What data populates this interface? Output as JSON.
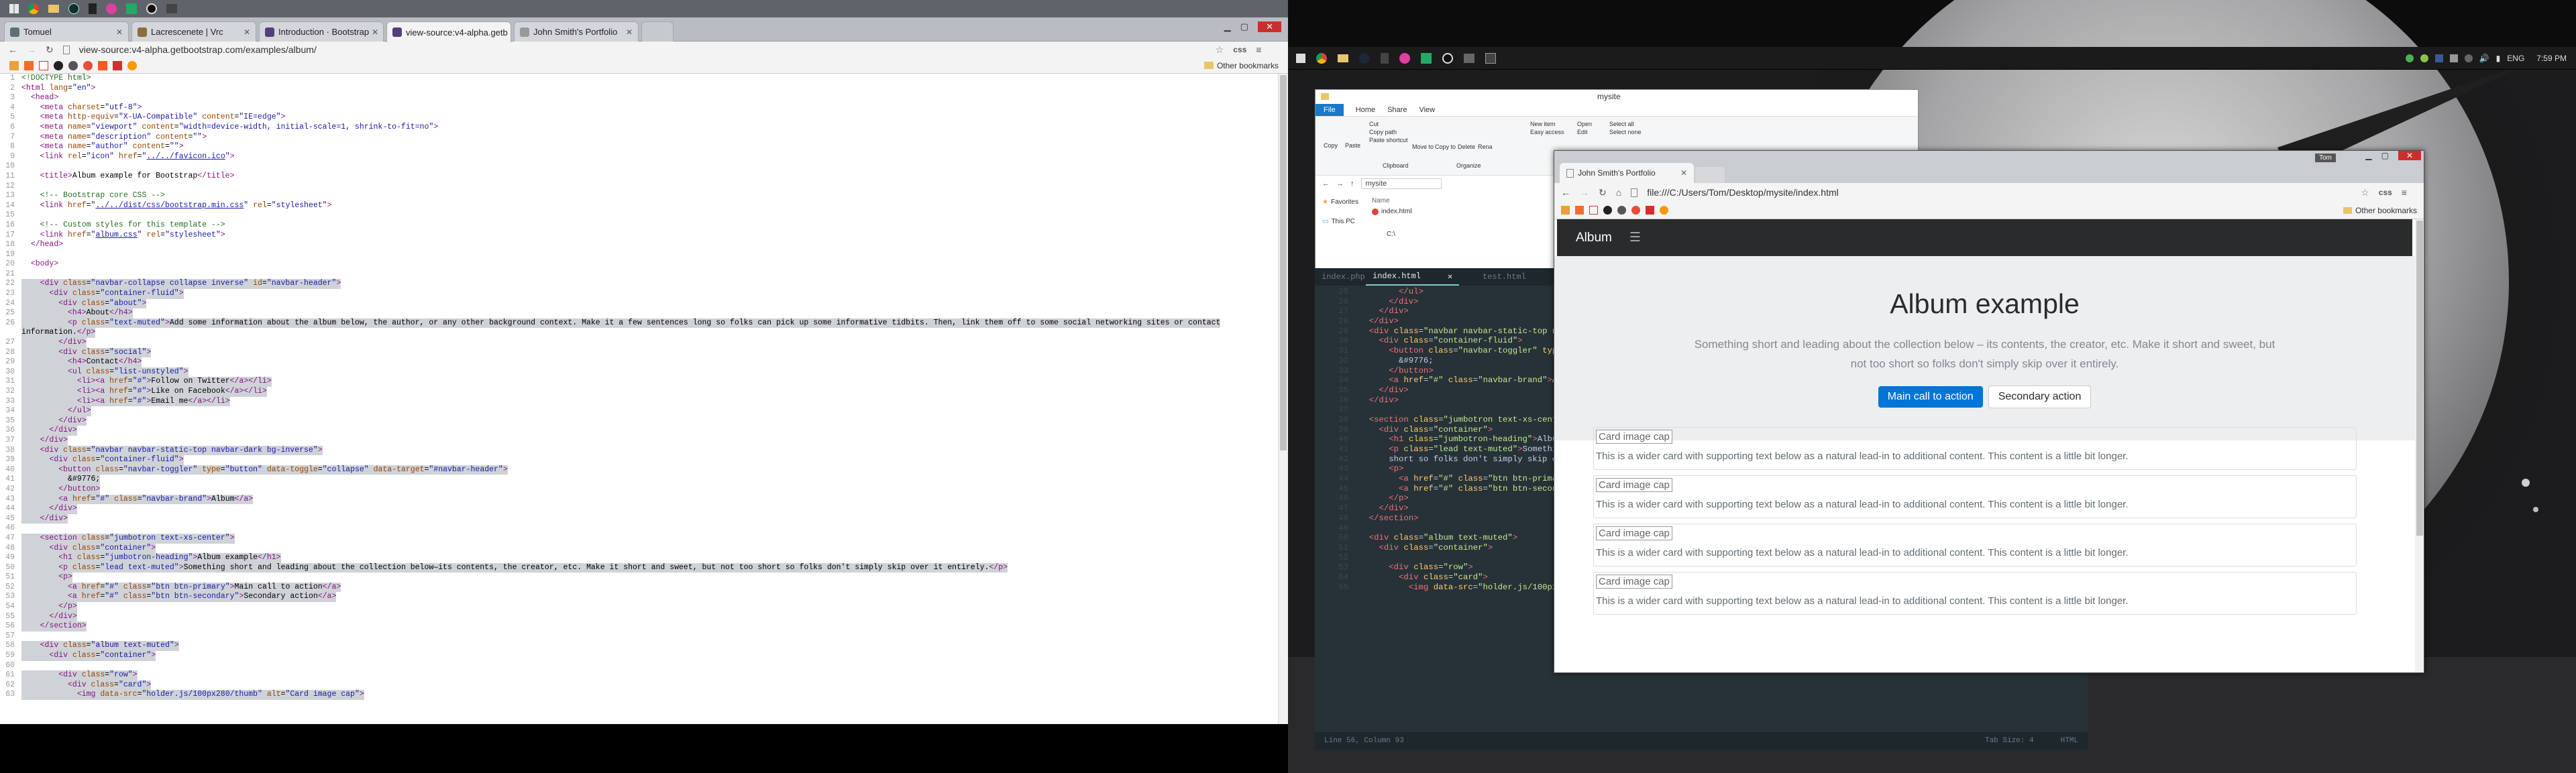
{
  "left_browser": {
    "tabs": [
      {
        "label": "Tomuel",
        "color": "#5f6f7a"
      },
      {
        "label": "Lacrescenete | Vrc",
        "color": "#8a6d3b"
      },
      {
        "label": "Introduction · Bootstrap",
        "color": "#563d7c"
      },
      {
        "label": "view-source:v4-alpha.getb",
        "color": "#563d7c"
      },
      {
        "label": "John Smith's Portfolio",
        "color": "#999999"
      }
    ],
    "url": "view-source:v4-alpha.getbootstrap.com/examples/album/",
    "url_suffix": "css",
    "other_bookmarks": "Other bookmarks",
    "code_lines": [
      {
        "html": "<span class='c'>&lt;!DOCTYPE html&gt;</span>"
      },
      {
        "html": "<span class='t'>&lt;html</span> <span class='a'>lang</span>=<span class='v'>\"en\"</span><span class='t'>&gt;</span>"
      },
      {
        "html": "  <span class='t'>&lt;head&gt;</span>"
      },
      {
        "html": "    <span class='t'>&lt;meta</span> <span class='a'>charset</span>=<span class='v'>\"utf-8\"</span><span class='t'>&gt;</span>"
      },
      {
        "html": "    <span class='t'>&lt;meta</span> <span class='a'>http-equiv</span>=<span class='v'>\"X-UA-Compatible\"</span> <span class='a'>content</span>=<span class='v'>\"IE=edge\"</span><span class='t'>&gt;</span>"
      },
      {
        "html": "    <span class='t'>&lt;meta</span> <span class='a'>name</span>=<span class='v'>\"viewport\"</span> <span class='a'>content</span>=<span class='v'>\"width=device-width, initial-scale=1, shrink-to-fit=no\"</span><span class='t'>&gt;</span>"
      },
      {
        "html": "    <span class='t'>&lt;meta</span> <span class='a'>name</span>=<span class='v'>\"description\"</span> <span class='a'>content</span>=<span class='v'>\"\"</span><span class='t'>&gt;</span>"
      },
      {
        "html": "    <span class='t'>&lt;meta</span> <span class='a'>name</span>=<span class='v'>\"author\"</span> <span class='a'>content</span>=<span class='v'>\"\"</span><span class='t'>&gt;</span>"
      },
      {
        "html": "    <span class='t'>&lt;link</span> <span class='a'>rel</span>=<span class='v'>\"icon\"</span> <span class='a'>href</span>=<span class='v'>\"</span><span class='lk'>../../favicon.ico</span><span class='v'>\"</span><span class='t'>&gt;</span>"
      },
      {
        "html": ""
      },
      {
        "html": "    <span class='t'>&lt;title&gt;</span>Album example for Bootstrap<span class='t'>&lt;/title&gt;</span>"
      },
      {
        "html": ""
      },
      {
        "html": "    <span class='c'>&lt;!-- Bootstrap core CSS --&gt;</span>"
      },
      {
        "html": "    <span class='t'>&lt;link</span> <span class='a'>href</span>=<span class='v'>\"</span><span class='lk'>../../dist/css/bootstrap.min.css</span><span class='v'>\"</span> <span class='a'>rel</span>=<span class='v'>\"stylesheet\"</span><span class='t'>&gt;</span>"
      },
      {
        "html": ""
      },
      {
        "html": "    <span class='c'>&lt;!-- Custom styles for this template --&gt;</span>"
      },
      {
        "html": "    <span class='t'>&lt;link</span> <span class='a'>href</span>=<span class='v'>\"</span><span class='lk'>album.css</span><span class='v'>\"</span> <span class='a'>rel</span>=<span class='v'>\"stylesheet\"</span><span class='t'>&gt;</span>"
      },
      {
        "html": "  <span class='t'>&lt;/head&gt;</span>"
      },
      {
        "html": ""
      },
      {
        "html": "  <span class='t'>&lt;body&gt;</span>"
      },
      {
        "html": ""
      },
      {
        "html": "    <span class='t'>&lt;div</span> <span class='a'>class</span>=<span class='v'>\"navbar-collapse collapse inverse\"</span> <span class='a'>id</span>=<span class='v'>\"navbar-header\"</span><span class='t'>&gt;</span>",
        "sel": true
      },
      {
        "html": "      <span class='t'>&lt;div</span> <span class='a'>class</span>=<span class='v'>\"container-fluid\"</span><span class='t'>&gt;</span>",
        "sel": true
      },
      {
        "html": "        <span class='t'>&lt;div</span> <span class='a'>class</span>=<span class='v'>\"about\"</span><span class='t'>&gt;</span>",
        "sel": true
      },
      {
        "html": "          <span class='t'>&lt;h4&gt;</span>About<span class='t'>&lt;/h4&gt;</span>",
        "sel": true
      },
      {
        "html": "          <span class='t'>&lt;p</span> <span class='a'>class</span>=<span class='v'>\"text-muted\"</span><span class='t'>&gt;</span>Add some information about the album below, the author, or any other background context. Make it a few sentences long so folks can pick up some informative tidbits. Then, link them off to some social networking sites or contact",
        "sel": true
      },
      {
        "html": "information.<span class='t'>&lt;/p&gt;</span>",
        "sel": true,
        "nonum": true
      },
      {
        "html": "        <span class='t'>&lt;/div&gt;</span>",
        "sel": true
      },
      {
        "html": "        <span class='t'>&lt;div</span> <span class='a'>class</span>=<span class='v'>\"social\"</span><span class='t'>&gt;</span>",
        "sel": true
      },
      {
        "html": "          <span class='t'>&lt;h4&gt;</span>Contact<span class='t'>&lt;/h4&gt;</span>",
        "sel": true
      },
      {
        "html": "          <span class='t'>&lt;ul</span> <span class='a'>class</span>=<span class='v'>\"list-unstyled\"</span><span class='t'>&gt;</span>",
        "sel": true
      },
      {
        "html": "            <span class='t'>&lt;li&gt;&lt;a</span> <span class='a'>href</span>=<span class='v'>\"#\"</span><span class='t'>&gt;</span>Follow on Twitter<span class='t'>&lt;/a&gt;&lt;/li&gt;</span>",
        "sel": true
      },
      {
        "html": "            <span class='t'>&lt;li&gt;&lt;a</span> <span class='a'>href</span>=<span class='v'>\"#\"</span><span class='t'>&gt;</span>Like on Facebook<span class='t'>&lt;/a&gt;&lt;/li&gt;</span>",
        "sel": true
      },
      {
        "html": "            <span class='t'>&lt;li&gt;&lt;a</span> <span class='a'>href</span>=<span class='v'>\"#\"</span><span class='t'>&gt;</span>Email me<span class='t'>&lt;/a&gt;&lt;/li&gt;</span>",
        "sel": true
      },
      {
        "html": "          <span class='t'>&lt;/ul&gt;</span>",
        "sel": true
      },
      {
        "html": "        <span class='t'>&lt;/div&gt;</span>",
        "sel": true
      },
      {
        "html": "      <span class='t'>&lt;/div&gt;</span>",
        "sel": true
      },
      {
        "html": "    <span class='t'>&lt;/div&gt;</span>",
        "sel": true
      },
      {
        "html": "    <span class='t'>&lt;div</span> <span class='a'>class</span>=<span class='v'>\"navbar navbar-static-top navbar-dark bg-inverse\"</span><span class='t'>&gt;</span>",
        "sel": true
      },
      {
        "html": "      <span class='t'>&lt;div</span> <span class='a'>class</span>=<span class='v'>\"container-fluid\"</span><span class='t'>&gt;</span>",
        "sel": true
      },
      {
        "html": "        <span class='t'>&lt;button</span> <span class='a'>class</span>=<span class='v'>\"navbar-toggler\"</span> <span class='a'>type</span>=<span class='v'>\"button\"</span> <span class='a'>data-toggle</span>=<span class='v'>\"collapse\"</span> <span class='a'>data-target</span>=<span class='v'>\"#navbar-header\"</span><span class='t'>&gt;</span>",
        "sel": true
      },
      {
        "html": "          &amp;#9776;",
        "sel": true
      },
      {
        "html": "        <span class='t'>&lt;/button&gt;</span>",
        "sel": true
      },
      {
        "html": "        <span class='t'>&lt;a</span> <span class='a'>href</span>=<span class='v'>\"#\"</span> <span class='a'>class</span>=<span class='v'>\"navbar-brand\"</span><span class='t'>&gt;</span>Album<span class='t'>&lt;/a&gt;</span>",
        "sel": true
      },
      {
        "html": "      <span class='t'>&lt;/div&gt;</span>",
        "sel": true
      },
      {
        "html": "    <span class='t'>&lt;/div&gt;</span>",
        "sel": true
      },
      {
        "html": ""
      },
      {
        "html": "    <span class='t'>&lt;section</span> <span class='a'>class</span>=<span class='v'>\"jumbotron text-xs-center\"</span><span class='t'>&gt;</span>",
        "sel": true
      },
      {
        "html": "      <span class='t'>&lt;div</span> <span class='a'>class</span>=<span class='v'>\"container\"</span><span class='t'>&gt;</span>",
        "sel": true
      },
      {
        "html": "        <span class='t'>&lt;h1</span> <span class='a'>class</span>=<span class='v'>\"jumbotron-heading\"</span><span class='t'>&gt;</span>Album example<span class='t'>&lt;/h1&gt;</span>",
        "sel": true
      },
      {
        "html": "        <span class='t'>&lt;p</span> <span class='a'>class</span>=<span class='v'>\"lead text-muted\"</span><span class='t'>&gt;</span>Something short and leading about the collection below—its contents, the creator, etc. Make it short and sweet, but not too short so folks don't simply skip over it entirely.<span class='t'>&lt;/p&gt;</span>",
        "sel": true
      },
      {
        "html": "        <span class='t'>&lt;p&gt;</span>",
        "sel": true
      },
      {
        "html": "          <span class='t'>&lt;a</span> <span class='a'>href</span>=<span class='v'>\"#\"</span> <span class='a'>class</span>=<span class='v'>\"btn btn-primary\"</span><span class='t'>&gt;</span>Main call to action<span class='t'>&lt;/a&gt;</span>",
        "sel": true
      },
      {
        "html": "          <span class='t'>&lt;a</span> <span class='a'>href</span>=<span class='v'>\"#\"</span> <span class='a'>class</span>=<span class='v'>\"btn btn-secondary\"</span><span class='t'>&gt;</span>Secondary action<span class='t'>&lt;/a&gt;</span>",
        "sel": true
      },
      {
        "html": "        <span class='t'>&lt;/p&gt;</span>",
        "sel": true
      },
      {
        "html": "      <span class='t'>&lt;/div&gt;</span>",
        "sel": true
      },
      {
        "html": "    <span class='t'>&lt;/section&gt;</span>",
        "sel": true
      },
      {
        "html": ""
      },
      {
        "html": "    <span class='t'>&lt;div</span> <span class='a'>class</span>=<span class='v'>\"album text-muted\"</span><span class='t'>&gt;</span>",
        "sel": true
      },
      {
        "html": "      <span class='t'>&lt;div</span> <span class='a'>class</span>=<span class='v'>\"container\"</span><span class='t'>&gt;</span>",
        "sel": true
      },
      {
        "html": ""
      },
      {
        "html": "        <span class='t'>&lt;div</span> <span class='a'>class</span>=<span class='v'>\"row\"</span><span class='t'>&gt;</span>",
        "sel": true
      },
      {
        "html": "          <span class='t'>&lt;div</span> <span class='a'>class</span>=<span class='v'>\"card\"</span><span class='t'>&gt;</span>",
        "sel": true
      },
      {
        "html": "            <span class='t'>&lt;img</span> <span class='a'>data-src</span>=<span class='v'>\"holder.js/100px280/thumb\"</span> <span class='a'>alt</span>=<span class='v'>\"Card image cap\"</span><span class='t'>&gt;</span>",
        "sel": true
      }
    ]
  },
  "taskbar": {
    "language": "ENG",
    "time": "7:59 PM"
  },
  "explorer": {
    "title": "mysite",
    "ribbon_tabs": [
      "File",
      "Home",
      "Share",
      "View"
    ],
    "ribbon_buttons": [
      "Copy",
      "Paste",
      "Cut",
      "Copy path",
      "Paste shortcut",
      "Move to",
      "Copy to",
      "Delete",
      "Rena",
      "New item",
      "Easy access",
      "Open",
      "Edit",
      "Select all",
      "Select none"
    ],
    "groups": [
      "Clipboard",
      "Organize"
    ],
    "path": "mysite",
    "quick_access": [
      "Favorites",
      "This PC"
    ],
    "column": "Name",
    "file": "index.html",
    "drive": "C:\\"
  },
  "editor": {
    "tabs": [
      "index.php",
      "index.html",
      "test.html"
    ],
    "line_numbers": [
      25,
      26,
      27,
      28,
      29,
      30,
      31,
      32,
      33,
      34,
      35,
      36,
      37,
      38,
      39,
      40,
      41,
      42,
      43,
      44,
      45,
      46,
      47,
      48,
      49,
      50,
      51,
      52,
      53,
      54,
      55,
      56,
      57,
      58,
      59,
      60,
      61,
      62,
      63,
      64,
      65,
      66,
      67,
      68,
      69,
      70,
      71,
      72,
      73,
      74,
      75,
      76,
      77
    ],
    "lines": [
      "        <span class='et'>&lt;/ul&gt;</span>",
      "      <span class='et'>&lt;/div&gt;</span>",
      "    <span class='et'>&lt;/div&gt;</span>",
      "  <span class='et'>&lt;/div&gt;</span>",
      "  <span class='et'>&lt;div</span> <span class='ea'>class</span>=<span class='ev'>\"navbar navbar-static-top navbar-dark bg-inverse\"</span><span class='et'>&gt;</span>",
      "    <span class='et'>&lt;div</span> <span class='ea'>class</span>=<span class='ev'>\"container-fluid\"</span><span class='et'>&gt;</span>",
      "      <span class='et'>&lt;button</span> <span class='ea'>class</span>=<span class='ev'>\"navbar-toggler\"</span> <span class='ea'>type</span>=<span class='ev'>\"button\"</span> <span class='ea'>data-toggle</span>=<span class='ev'>\"collapse\"</span>",
      "        &amp;#9776;",
      "      <span class='et'>&lt;/button&gt;</span>",
      "      <span class='et'>&lt;a</span> <span class='ea'>href</span>=<span class='ev'>\"#\"</span> <span class='ea'>class</span>=<span class='ev'>\"navbar-brand\"</span><span class='et'>&gt;</span>Album<span class='et'>&lt;/a&gt;</span>",
      "    <span class='et'>&lt;/div&gt;</span>",
      "  <span class='et'>&lt;/div&gt;</span>",
      "",
      "  <span class='et'>&lt;section</span> <span class='ea'>class</span>=<span class='ev'>\"jumbotron text-xs-center\"</span><span class='et'>&gt;</span>",
      "    <span class='et'>&lt;div</span> <span class='ea'>class</span>=<span class='ev'>\"container\"</span><span class='et'>&gt;</span>",
      "      <span class='et'>&lt;h1</span> <span class='ea'>class</span>=<span class='ev'>\"jumbotron-heading\"</span><span class='et'>&gt;</span>Album example<span class='et'>&lt;/h1&gt;</span>",
      "      <span class='et'>&lt;p</span> <span class='ea'>class</span>=<span class='ev'>\"lead text-muted\"</span><span class='et'>&gt;</span>Something short and leading about the collection below",
      "      short so folks don't simply skip over it entirely.<span class='et'>&lt;/p&gt;</span>",
      "      <span class='et'>&lt;p&gt;</span>",
      "        <span class='et'>&lt;a</span> <span class='ea'>href</span>=<span class='ev'>\"#\"</span> <span class='ea'>class</span>=<span class='ev'>\"btn btn-primary\"</span><span class='et'>&gt;</span>Main call to action<span class='et'>&lt;/a&gt;</span>",
      "        <span class='et'>&lt;a</span> <span class='ea'>href</span>=<span class='ev'>\"#\"</span> <span class='ea'>class</span>=<span class='ev'>\"btn btn-secondary\"</span><span class='et'>&gt;</span>Secondary action<span class='et'>&lt;/a&gt;</span>",
      "      <span class='et'>&lt;/p&gt;</span>",
      "    <span class='et'>&lt;/div&gt;</span>",
      "  <span class='et'>&lt;/section&gt;</span>",
      "",
      "  <span class='et'>&lt;div</span> <span class='ea'>class</span>=<span class='ev'>\"album text-muted\"</span><span class='et'>&gt;</span>",
      "    <span class='et'>&lt;div</span> <span class='ea'>class</span>=<span class='ev'>\"container\"</span><span class='et'>&gt;</span>",
      "",
      "      <span class='et'>&lt;div</span> <span class='ea'>class</span>=<span class='ev'>\"row\"</span><span class='et'>&gt;</span>",
      "        <span class='et'>&lt;div</span> <span class='ea'>class</span>=<span class='ev'>\"card\"</span><span class='et'>&gt;</span>",
      "          <span class='et'>&lt;img</span> <span class='ea'>data-src</span>=<span class='ev'>\"holder.js/100px280/thumb\"</span> <span class='ea'>alt</span>=<span class='ev'>\"Card image cap\"</span><span class='et'>&gt;</span>"
    ],
    "status_left": "Line 56, Column 93",
    "status_tab": "Tab Size: 4",
    "status_lang": "HTML"
  },
  "chrome": {
    "tab": "John Smith's Portfolio",
    "user": "Tom",
    "url": "file:///C:/Users/Tom/Desktop/mysite/index.html",
    "url_suffix": "css",
    "other_bookmarks": "Other bookmarks",
    "page": {
      "brand": "Album",
      "toggler": "☰",
      "heading": "Album example",
      "lead": "Something short and leading about the collection below – its contents, the creator, etc. Make it short and sweet, but not too short so folks don't simply skip over it entirely.",
      "primary_btn": "Main call to action",
      "secondary_btn": "Secondary action",
      "cards": [
        {
          "img": "Card image cap",
          "text": "This is a wider card with supporting text below as a natural lead-in to additional content. This content is a little bit longer."
        },
        {
          "img": "Card image cap",
          "text": "This is a wider card with supporting text below as a natural lead-in to additional content. This content is a little bit longer."
        },
        {
          "img": "Card image cap",
          "text": "This is a wider card with supporting text below as a natural lead-in to additional content. This content is a little bit longer."
        },
        {
          "img": "Card image cap",
          "text": "This is a wider card with supporting text below as a natural lead-in to additional content. This content is a little bit longer."
        }
      ]
    }
  },
  "colors": {
    "primary": "#0275d8",
    "navbar": "#292b2c",
    "jumbotron": "#eceeef",
    "editor_bg": "#263238"
  }
}
